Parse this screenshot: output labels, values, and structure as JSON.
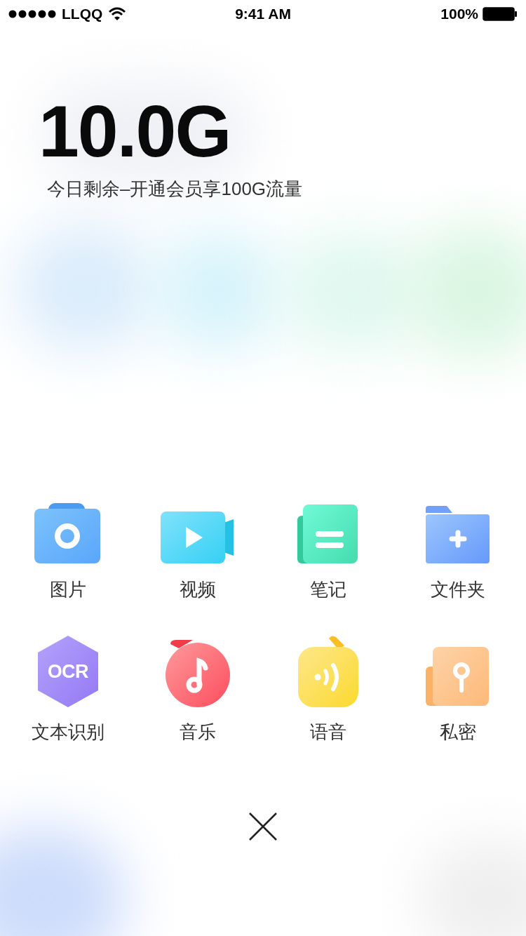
{
  "status_bar": {
    "carrier": "LLQQ",
    "time": "9:41 AM",
    "battery": "100%"
  },
  "quota": {
    "amount": "10.0G",
    "caption": "今日剩余–开通会员享100G流量"
  },
  "actions": [
    {
      "kind": "photo",
      "label": "图片"
    },
    {
      "kind": "video",
      "label": "视频"
    },
    {
      "kind": "note",
      "label": "笔记"
    },
    {
      "kind": "folder",
      "label": "文件夹"
    },
    {
      "kind": "ocr",
      "label": "文本识别",
      "icon_text": "OCR"
    },
    {
      "kind": "music",
      "label": "音乐"
    },
    {
      "kind": "voice",
      "label": "语音"
    },
    {
      "kind": "private",
      "label": "私密"
    }
  ]
}
